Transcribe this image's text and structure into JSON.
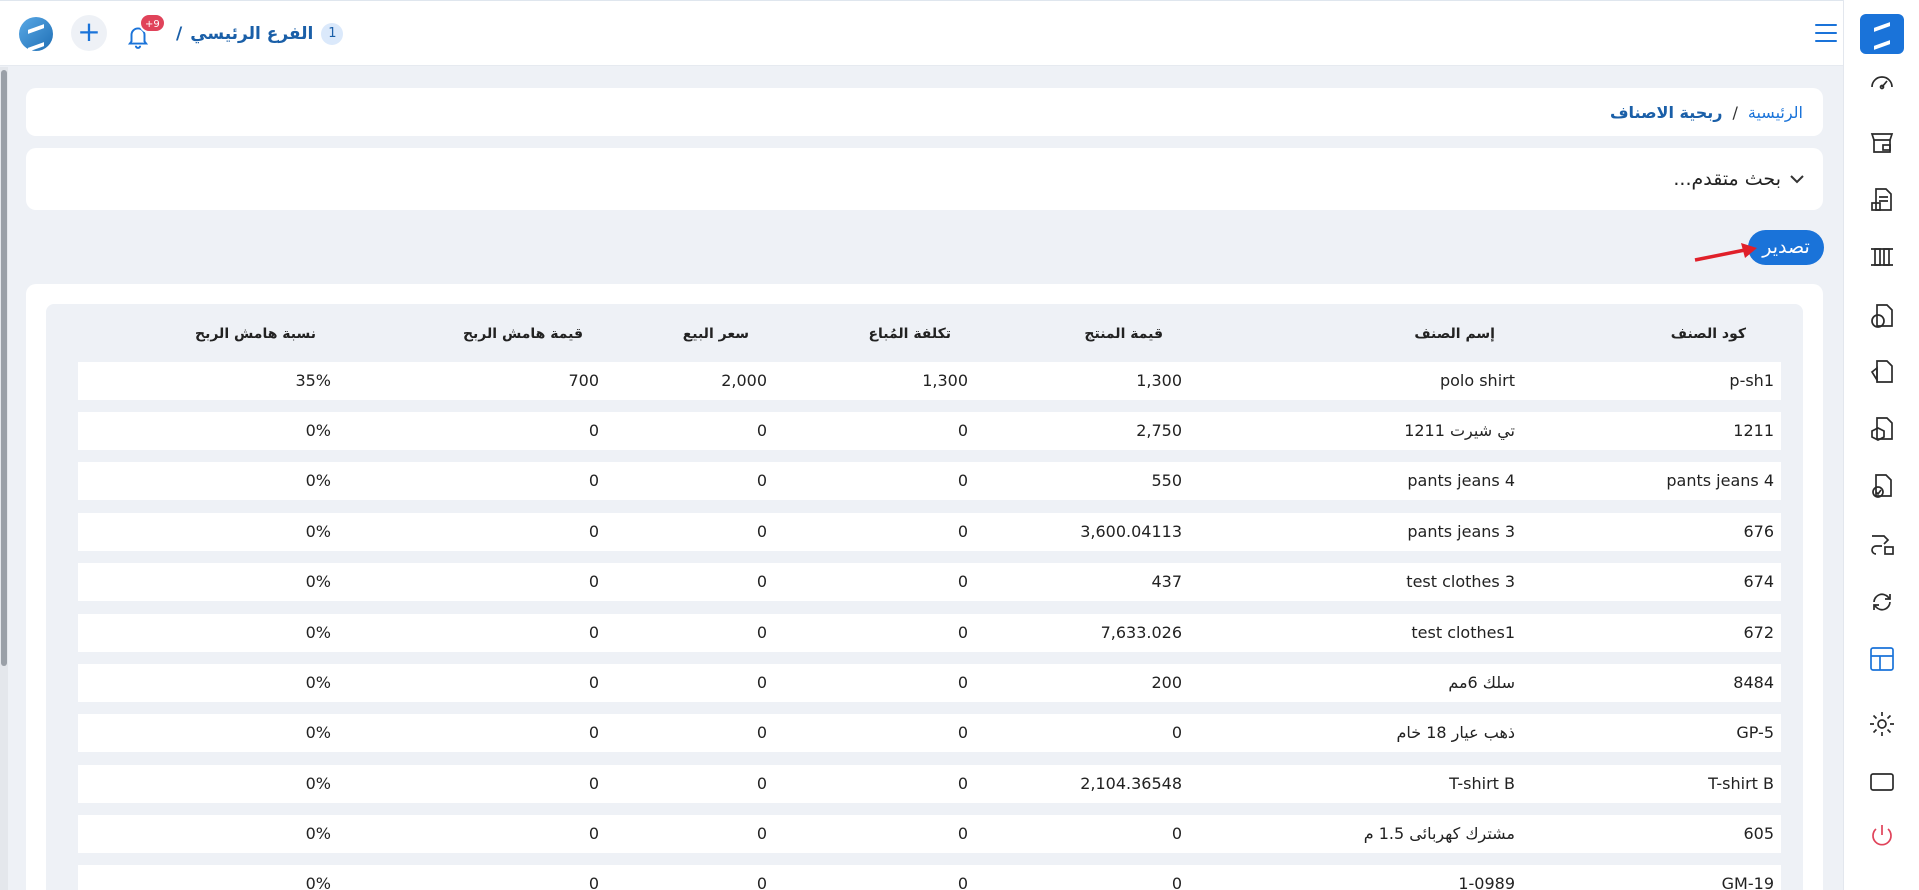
{
  "topbar": {
    "branch_number": "1",
    "branch_name": "الفرع الرئيسي",
    "branch_separator": "/",
    "notification_badge": "+9"
  },
  "breadcrumb": {
    "home": "الرئيسية",
    "separator": "/",
    "current": "ربحية الاصناف"
  },
  "advanced_search": {
    "label": "بحث متقدم..."
  },
  "export_button": {
    "label": "تصدير"
  },
  "table": {
    "headers": [
      "كود الصنف",
      "إسم الصنف",
      "قيمة المنتج",
      "تكلفة المُباع",
      "سعر البيع",
      "قيمة هامش الربح",
      "نسبة هامش الربح"
    ],
    "rows": [
      [
        "p-sh1",
        "polo shirt",
        "1,300",
        "1,300",
        "2,000",
        "700",
        "35%"
      ],
      [
        "1211",
        "تي شيرت 1211",
        "2,750",
        "0",
        "0",
        "0",
        "0%"
      ],
      [
        "pants jeans  4",
        "pants jeans  4",
        "550",
        "0",
        "0",
        "0",
        "0%"
      ],
      [
        "676",
        "pants jeans  3",
        "3,600.04113",
        "0",
        "0",
        "0",
        "0%"
      ],
      [
        "674",
        "test clothes 3",
        "437",
        "0",
        "0",
        "0",
        "0%"
      ],
      [
        "672",
        "test clothes1",
        "7,633.026",
        "0",
        "0",
        "0",
        "0%"
      ],
      [
        "8484",
        "سلك 6مم",
        "200",
        "0",
        "0",
        "0",
        "0%"
      ],
      [
        "GP-5",
        "ذهب عيار 18 خام",
        "0",
        "0",
        "0",
        "0",
        "0%"
      ],
      [
        "T-shirt B",
        "T-shirt B",
        "2,104.36548",
        "0",
        "0",
        "0",
        "0%"
      ],
      [
        "605",
        "مشترك كهربائى 1.5 م",
        "0",
        "0",
        "0",
        "0",
        "0%"
      ],
      [
        "GM-19",
        "1-0989",
        "0",
        "0",
        "0",
        "0",
        "0%"
      ]
    ]
  },
  "colors": {
    "accent": "#1a73d9",
    "background": "#eef1f6",
    "badge": "#e0435a"
  },
  "sidebar_icons": [
    "dashboard-icon",
    "store-icon",
    "invoice-icon",
    "columns-icon",
    "money-icon",
    "document-icon",
    "box-doc-icon",
    "approved-doc-icon",
    "transfer-icon",
    "sync-icon",
    "reports-icon",
    "settings-icon",
    "screen-icon",
    "power-icon"
  ]
}
